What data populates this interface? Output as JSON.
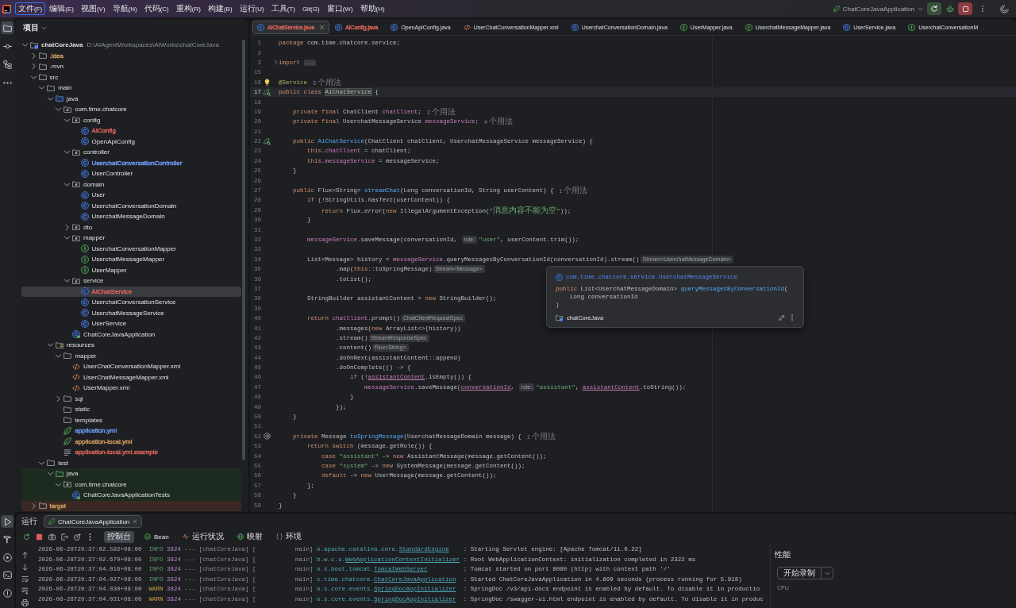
{
  "title_bar": {
    "menu": [
      {
        "label": "文件(F)",
        "selected": true
      },
      {
        "label": "编辑(E)",
        "selected": false
      },
      {
        "label": "视图(V)",
        "selected": false
      },
      {
        "label": "导航(N)",
        "selected": false
      },
      {
        "label": "代码(C)",
        "selected": false
      },
      {
        "label": "重构(R)",
        "selected": false
      },
      {
        "label": "构建(B)",
        "selected": false
      },
      {
        "label": "运行(U)",
        "selected": false
      },
      {
        "label": "工具(T)",
        "selected": false
      },
      {
        "label": "Git(G)",
        "selected": false
      },
      {
        "label": "窗口(W)",
        "selected": false
      },
      {
        "label": "帮助(H)",
        "selected": false
      }
    ],
    "run_config": {
      "label": "ChatCoreJavaApplication"
    }
  },
  "tool_strip": [
    {
      "kind": "project",
      "selected": true
    },
    {
      "kind": "commit",
      "selected": false
    },
    {
      "kind": "structure",
      "selected": false
    },
    {
      "kind": "more",
      "selected": false
    }
  ],
  "project": {
    "title": "项目",
    "tree": {
      "label": "chatCoreJava",
      "path": "D:\\AIAgentWorkspaces\\AIWorks\\chatCoreJava",
      "kind": "module",
      "expanded": true,
      "selected": false,
      "children": [
        {
          "label": ".idea",
          "kind": "folder",
          "expanded": false,
          "selected": false,
          "color": "#cf9a5e"
        },
        {
          "label": ".mvn",
          "kind": "folder",
          "expanded": false,
          "selected": false
        },
        {
          "label": "src",
          "kind": "folder",
          "expanded": true,
          "selected": false,
          "children": [
            {
              "label": "main",
              "kind": "folder",
              "expanded": true,
              "selected": false,
              "children": [
                {
                  "label": "java",
                  "kind": "source-folder",
                  "expanded": true,
                  "selected": false,
                  "children": [
                    {
                      "label": "com.time.chatcore",
                      "kind": "package",
                      "expanded": true,
                      "selected": false,
                      "children": [
                        {
                          "label": "config",
                          "kind": "package",
                          "expanded": true,
                          "selected": false,
                          "children": [
                            {
                              "label": "AiConfig",
                              "kind": "class",
                              "selected": false,
                              "color": "#d8645a"
                            },
                            {
                              "label": "OpenApiConfig",
                              "kind": "class",
                              "selected": false
                            }
                          ]
                        },
                        {
                          "label": "controller",
                          "kind": "package",
                          "expanded": true,
                          "selected": false,
                          "children": [
                            {
                              "label": "UserchatConversationController",
                              "kind": "class",
                              "selected": false,
                              "color": "#6b9bf5"
                            },
                            {
                              "label": "UserController",
                              "kind": "class",
                              "selected": false
                            }
                          ]
                        },
                        {
                          "label": "domain",
                          "kind": "package",
                          "expanded": true,
                          "selected": false,
                          "children": [
                            {
                              "label": "User",
                              "kind": "class",
                              "selected": false
                            },
                            {
                              "label": "UserchatConversationDomain",
                              "kind": "class",
                              "selected": false
                            },
                            {
                              "label": "UserchatMessageDomain",
                              "kind": "class",
                              "selected": false
                            }
                          ]
                        },
                        {
                          "label": "dto",
                          "kind": "package",
                          "expanded": false,
                          "selected": false
                        },
                        {
                          "label": "mapper",
                          "kind": "package",
                          "expanded": true,
                          "selected": false,
                          "children": [
                            {
                              "label": "UserchatConversationMapper",
                              "kind": "interface",
                              "selected": false
                            },
                            {
                              "label": "UserchatMessageMapper",
                              "kind": "interface",
                              "selected": false
                            },
                            {
                              "label": "UserMapper",
                              "kind": "interface",
                              "selected": false
                            }
                          ]
                        },
                        {
                          "label": "service",
                          "kind": "package",
                          "expanded": true,
                          "selected": false,
                          "children": [
                            {
                              "label": "AiChatService",
                              "kind": "class",
                              "selected": true,
                              "color": "#d8645a"
                            },
                            {
                              "label": "UserchatConversationService",
                              "kind": "class",
                              "selected": false
                            },
                            {
                              "label": "UserchatMessageService",
                              "kind": "class",
                              "selected": false
                            },
                            {
                              "label": "UserService",
                              "kind": "class",
                              "selected": false
                            }
                          ]
                        },
                        {
                          "label": "ChatCoreJavaApplication",
                          "kind": "app-class",
                          "selected": false
                        }
                      ]
                    }
                  ]
                },
                {
                  "label": "resources",
                  "kind": "resource-folder",
                  "expanded": true,
                  "selected": false,
                  "children": [
                    {
                      "label": "mapper",
                      "kind": "folder",
                      "expanded": true,
                      "selected": false,
                      "children": [
                        {
                          "label": "UserChatConversationMapper.xml",
                          "kind": "xml",
                          "selected": false
                        },
                        {
                          "label": "UserChatMessageMapper.xml",
                          "kind": "xml",
                          "selected": false
                        },
                        {
                          "label": "UserMapper.xml",
                          "kind": "xml",
                          "selected": false
                        }
                      ]
                    },
                    {
                      "label": "sql",
                      "kind": "folder",
                      "expanded": false,
                      "selected": false
                    },
                    {
                      "label": "static",
                      "kind": "folder",
                      "selected": false
                    },
                    {
                      "label": "templates",
                      "kind": "folder",
                      "selected": false
                    },
                    {
                      "label": "application.yml",
                      "kind": "spring-config",
                      "selected": false,
                      "color": "#6b9bf5"
                    },
                    {
                      "label": "application-local.yml",
                      "kind": "spring-config",
                      "selected": false,
                      "color": "#cf9a5e"
                    },
                    {
                      "label": "application-local.yml.example",
                      "kind": "text",
                      "selected": false,
                      "color": "#d8645a"
                    }
                  ]
                }
              ]
            },
            {
              "label": "test",
              "kind": "folder",
              "expanded": true,
              "selected": false,
              "children": [
                {
                  "label": "java",
                  "kind": "test-folder",
                  "expanded": true,
                  "selected": false,
                  "children": [
                    {
                      "label": "com.time.chatcore",
                      "kind": "test-package",
                      "expanded": true,
                      "selected": false,
                      "children": [
                        {
                          "label": "ChatCoreJavaApplicationTests",
                          "kind": "test-class",
                          "selected": false
                        }
                      ]
                    }
                  ]
                }
              ]
            }
          ]
        },
        {
          "label": "target",
          "kind": "excluded-folder",
          "expanded": false,
          "selected": false,
          "color": "#cf9a5e"
        }
      ]
    }
  },
  "editor": {
    "tabs": [
      {
        "label": "AiChatService.java",
        "kind": "class",
        "selected": true,
        "color": "#d8645a"
      },
      {
        "label": "AiConfig.java",
        "kind": "class",
        "selected": false,
        "color": "#d8645a"
      },
      {
        "label": "OpenApiConfig.java",
        "kind": "class",
        "selected": false
      },
      {
        "label": "UserChatConversationMapper.xml",
        "kind": "xml",
        "selected": false
      },
      {
        "label": "UserchatConversationDomain.java",
        "kind": "class",
        "selected": false
      },
      {
        "label": "UserMapper.java",
        "kind": "interface",
        "selected": false
      },
      {
        "label": "UserchatMessageMapper.java",
        "kind": "interface",
        "selected": false
      },
      {
        "label": "UserService.java",
        "kind": "class",
        "selected": false
      },
      {
        "label": "UserchatConversationM",
        "kind": "interface",
        "selected": false
      }
    ],
    "lines": [
      {
        "number": "1",
        "current": false,
        "tokens": [
          {
            "kind": "kw",
            "text": "package"
          },
          {
            "kind": "plain",
            "text": " com.time.chatcore.service;"
          }
        ]
      },
      {
        "number": "2",
        "current": false
      },
      {
        "number": "3",
        "current": false,
        "gutter": {
          "kind": "fold"
        },
        "tokens": [
          {
            "kind": "kw",
            "text": "import "
          },
          {
            "kind": "fold",
            "text": "..."
          }
        ]
      },
      {
        "number": "15",
        "current": false
      },
      {
        "number": "16",
        "current": false,
        "gutter": {
          "kind": "bulb"
        },
        "tokens": [
          {
            "kind": "ann",
            "text": "@Service"
          },
          {
            "kind": "usage",
            "text": "3 个用法"
          }
        ]
      },
      {
        "number": "17",
        "current": true,
        "gutter": {
          "kind": "bean"
        },
        "tokens": [
          {
            "kind": "kw",
            "text": "public class "
          },
          {
            "kind": "ident",
            "text": "AiChatService"
          },
          {
            "kind": "plain",
            "text": " {"
          }
        ]
      },
      {
        "number": "18",
        "current": false
      },
      {
        "number": "19",
        "current": false,
        "tokens": [
          {
            "kind": "kw",
            "text": "    private final"
          },
          {
            "kind": "plain",
            "text": " ChatClient "
          },
          {
            "kind": "field",
            "text": "chatClient"
          },
          {
            "kind": "plain",
            "text": ";"
          },
          {
            "kind": "usage",
            "text": "2 个用法"
          }
        ]
      },
      {
        "number": "20",
        "current": false,
        "tokens": [
          {
            "kind": "kw",
            "text": "    private final"
          },
          {
            "kind": "plain",
            "text": " UserchatMessageService "
          },
          {
            "kind": "field",
            "text": "messageService"
          },
          {
            "kind": "plain",
            "text": ";"
          },
          {
            "kind": "usage",
            "text": "4 个用法"
          }
        ]
      },
      {
        "number": "21",
        "current": false
      },
      {
        "number": "22",
        "current": false,
        "gutter": {
          "kind": "bean"
        },
        "tokens": [
          {
            "kind": "kw",
            "text": "    public "
          },
          {
            "kind": "decl",
            "text": "AiChatService"
          },
          {
            "kind": "plain",
            "text": "(ChatClient chatClient, UserchatMessageService messageService) {"
          }
        ]
      },
      {
        "number": "23",
        "current": false,
        "tokens": [
          {
            "kind": "kw",
            "text": "        this"
          },
          {
            "kind": "plain",
            "text": "."
          },
          {
            "kind": "field",
            "text": "chatClient"
          },
          {
            "kind": "plain",
            "text": " = chatClient;"
          }
        ]
      },
      {
        "number": "24",
        "current": false,
        "tokens": [
          {
            "kind": "kw",
            "text": "        this"
          },
          {
            "kind": "plain",
            "text": "."
          },
          {
            "kind": "field",
            "text": "messageService"
          },
          {
            "kind": "plain",
            "text": " = messageService;"
          }
        ]
      },
      {
        "number": "25",
        "current": false,
        "tokens": [
          {
            "kind": "plain",
            "text": "    }"
          }
        ]
      },
      {
        "number": "26",
        "current": false
      },
      {
        "number": "27",
        "current": false,
        "tokens": [
          {
            "kind": "kw",
            "text": "    public"
          },
          {
            "kind": "plain",
            "text": " Flux<String> "
          },
          {
            "kind": "decl",
            "text": "streamChat"
          },
          {
            "kind": "plain",
            "text": "(Long conversationId, String userContent) {"
          },
          {
            "kind": "usage",
            "text": "1 个用法"
          }
        ]
      },
      {
        "number": "28",
        "current": false,
        "tokens": [
          {
            "kind": "kw",
            "text": "        if"
          },
          {
            "kind": "plain",
            "text": " (!StringUtils."
          },
          {
            "kind": "static",
            "text": "hasText"
          },
          {
            "kind": "plain",
            "text": "(userContent)) {"
          }
        ]
      },
      {
        "number": "29",
        "current": false,
        "tokens": [
          {
            "kind": "kw",
            "text": "            return"
          },
          {
            "kind": "plain",
            "text": " Flux."
          },
          {
            "kind": "static",
            "text": "error"
          },
          {
            "kind": "plain",
            "text": "("
          },
          {
            "kind": "kw",
            "text": "new"
          },
          {
            "kind": "plain",
            "text": " IllegalArgumentException("
          },
          {
            "kind": "str",
            "text": "\"消息内容不能为空\""
          },
          {
            "kind": "plain",
            "text": "));"
          }
        ]
      },
      {
        "number": "30",
        "current": false,
        "tokens": [
          {
            "kind": "plain",
            "text": "        }"
          }
        ]
      },
      {
        "number": "31",
        "current": false
      },
      {
        "number": "32",
        "current": false,
        "tokens": [
          {
            "kind": "field",
            "text": "        messageService"
          },
          {
            "kind": "plain",
            "text": ".saveMessage(conversationId, "
          },
          {
            "kind": "param",
            "text": "role:"
          },
          {
            "kind": "str",
            "text": "\"user\""
          },
          {
            "kind": "plain",
            "text": ", userContent.trim());"
          }
        ]
      },
      {
        "number": "33",
        "current": false
      },
      {
        "number": "34",
        "current": false,
        "tokens": [
          {
            "kind": "plain",
            "text": "        List<Message> history = "
          },
          {
            "kind": "field",
            "text": "messageService"
          },
          {
            "kind": "plain",
            "text": ".queryMessagesByConversationId(conversationId).stream()"
          },
          {
            "kind": "type",
            "text": "Stream<UserchatMessageDomain>"
          }
        ]
      },
      {
        "number": "35",
        "current": false,
        "tokens": [
          {
            "kind": "plain",
            "text": "                .map("
          },
          {
            "kind": "kw",
            "text": "this"
          },
          {
            "kind": "plain",
            "text": "::toSpringMessage)"
          },
          {
            "kind": "type",
            "text": "Stream<Message>"
          }
        ]
      },
      {
        "number": "36",
        "current": false,
        "tokens": [
          {
            "kind": "plain",
            "text": "                .toList();"
          }
        ]
      },
      {
        "number": "37",
        "current": false
      },
      {
        "number": "38",
        "current": false,
        "tokens": [
          {
            "kind": "plain",
            "text": "        StringBuilder assistantContent = "
          },
          {
            "kind": "kw",
            "text": "new"
          },
          {
            "kind": "plain",
            "text": " StringBuilder();"
          }
        ]
      },
      {
        "number": "39",
        "current": false
      },
      {
        "number": "40",
        "current": false,
        "tokens": [
          {
            "kind": "kw",
            "text": "        return "
          },
          {
            "kind": "field",
            "text": "chatClient"
          },
          {
            "kind": "plain",
            "text": ".prompt()"
          },
          {
            "kind": "type",
            "text": "ChatClientRequestSpec"
          }
        ]
      },
      {
        "number": "41",
        "current": false,
        "tokens": [
          {
            "kind": "plain",
            "text": "                .messages("
          },
          {
            "kind": "kw",
            "text": "new"
          },
          {
            "kind": "plain",
            "text": " ArrayList<>(history))"
          }
        ]
      },
      {
        "number": "42",
        "current": false,
        "tokens": [
          {
            "kind": "plain",
            "text": "                .stream()"
          },
          {
            "kind": "type",
            "text": "StreamResponseSpec"
          }
        ]
      },
      {
        "number": "43",
        "current": false,
        "tokens": [
          {
            "kind": "plain",
            "text": "                .content()"
          },
          {
            "kind": "type",
            "text": "Flux<String>"
          }
        ]
      },
      {
        "number": "44",
        "current": false,
        "tokens": [
          {
            "kind": "plain",
            "text": "                .doOnNext(assistantContent::append)"
          }
        ]
      },
      {
        "number": "45",
        "current": false,
        "tokens": [
          {
            "kind": "plain",
            "text": "                .doOnComplete(() -> {"
          }
        ]
      },
      {
        "number": "46",
        "current": false,
        "tokens": [
          {
            "kind": "kw",
            "text": "                    if"
          },
          {
            "kind": "plain",
            "text": " (!"
          },
          {
            "kind": "captured",
            "text": "assistantContent"
          },
          {
            "kind": "plain",
            "text": ".isEmpty()) {"
          }
        ]
      },
      {
        "number": "47",
        "current": false,
        "tokens": [
          {
            "kind": "field",
            "text": "                        messageService"
          },
          {
            "kind": "plain",
            "text": ".saveMessage("
          },
          {
            "kind": "captured",
            "text": "conversationId"
          },
          {
            "kind": "plain",
            "text": ", "
          },
          {
            "kind": "param",
            "text": "role:"
          },
          {
            "kind": "str",
            "text": "\"assistant\""
          },
          {
            "kind": "plain",
            "text": ", "
          },
          {
            "kind": "captured",
            "text": "assistantContent"
          },
          {
            "kind": "plain",
            "text": ".toString());"
          }
        ]
      },
      {
        "number": "48",
        "current": false,
        "tokens": [
          {
            "kind": "plain",
            "text": "                    }"
          }
        ]
      },
      {
        "number": "49",
        "current": false,
        "tokens": [
          {
            "kind": "plain",
            "text": "                });"
          }
        ]
      },
      {
        "number": "50",
        "current": false,
        "tokens": [
          {
            "kind": "plain",
            "text": "    }"
          }
        ]
      },
      {
        "number": "51",
        "current": false
      },
      {
        "number": "52",
        "current": false,
        "gutter": {
          "kind": "at"
        },
        "tokens": [
          {
            "kind": "kw",
            "text": "    private"
          },
          {
            "kind": "plain",
            "text": " Message "
          },
          {
            "kind": "decl",
            "text": "toSpringMessage"
          },
          {
            "kind": "plain",
            "text": "(UserchatMessageDomain message) {"
          },
          {
            "kind": "usage",
            "text": "1 个用法"
          }
        ]
      },
      {
        "number": "53",
        "current": false,
        "tokens": [
          {
            "kind": "kw",
            "text": "        return switch"
          },
          {
            "kind": "plain",
            "text": " (message.getRole()) {"
          }
        ]
      },
      {
        "number": "54",
        "current": false,
        "tokens": [
          {
            "kind": "kw",
            "text": "            case "
          },
          {
            "kind": "str",
            "text": "\"assistant\""
          },
          {
            "kind": "plain",
            "text": " -> "
          },
          {
            "kind": "kw",
            "text": "new"
          },
          {
            "kind": "plain",
            "text": " AssistantMessage(message.getContent());"
          }
        ]
      },
      {
        "number": "55",
        "current": false,
        "tokens": [
          {
            "kind": "kw",
            "text": "            case "
          },
          {
            "kind": "str",
            "text": "\"system\""
          },
          {
            "kind": "plain",
            "text": " -> "
          },
          {
            "kind": "kw",
            "text": "new"
          },
          {
            "kind": "plain",
            "text": " SystemMessage(message.getContent());"
          }
        ]
      },
      {
        "number": "56",
        "current": false,
        "tokens": [
          {
            "kind": "kw",
            "text": "            default"
          },
          {
            "kind": "plain",
            "text": " -> "
          },
          {
            "kind": "kw",
            "text": "new"
          },
          {
            "kind": "plain",
            "text": " UserMessage(message.getContent());"
          }
        ]
      },
      {
        "number": "57",
        "current": false,
        "tokens": [
          {
            "kind": "plain",
            "text": "        };"
          }
        ]
      },
      {
        "number": "58",
        "current": false,
        "tokens": [
          {
            "kind": "plain",
            "text": "    }"
          }
        ]
      },
      {
        "number": "59",
        "current": false,
        "tokens": [
          {
            "kind": "plain",
            "text": "}"
          }
        ]
      }
    ],
    "doc_popup": {
      "qualified_name": "com.time.chatcore.service.UserchatMessageService",
      "signature": [
        {
          "tokens": [
            {
              "kind": "kw",
              "text": "public"
            },
            {
              "kind": "plain",
              "text": " List<UserchatMessageDomain> "
            },
            {
              "kind": "decl",
              "text": "queryMessagesByConversationId"
            },
            {
              "kind": "plain",
              "text": "("
            }
          ]
        },
        {
          "tokens": [
            {
              "kind": "plain",
              "text": "    Long conversationId"
            }
          ]
        },
        {
          "tokens": [
            {
              "kind": "plain",
              "text": ")"
            }
          ]
        }
      ],
      "module": "chatCoreJava"
    }
  },
  "bottom_strip": [
    {
      "kind": "run",
      "selected": true
    },
    {
      "kind": "build",
      "selected": false
    },
    {
      "kind": "services",
      "selected": false
    },
    {
      "kind": "terminal",
      "selected": false
    },
    {
      "kind": "problems",
      "selected": false
    }
  ],
  "run": {
    "title": "运行",
    "tabs": [
      {
        "label": "ChatCoreJavaApplication",
        "selected": true
      }
    ],
    "views": [
      {
        "kind": "console",
        "label": "控制台",
        "selected": true
      },
      {
        "kind": "beans",
        "label": "Bean",
        "selected": false
      },
      {
        "kind": "health",
        "label": "运行状况",
        "selected": false
      },
      {
        "kind": "mappings",
        "label": "映射",
        "selected": false
      },
      {
        "kind": "environment",
        "label": "环境",
        "selected": false
      }
    ],
    "console": [
      {
        "kind": "info",
        "parts": [
          {
            "kind": "time",
            "text": "2026-06-28T20:37:02.592+08:00"
          },
          {
            "kind": "level",
            "text": "  INFO"
          },
          {
            "kind": "pid",
            "text": " 3824"
          },
          {
            "kind": "meta",
            "text": " --- [chatCoreJava] [           main] "
          },
          {
            "kind": "logger",
            "text": "o.apache.catalina.core."
          },
          {
            "kind": "link",
            "text": "StandardEngine"
          },
          {
            "kind": "msg",
            "text": "    : Starting Servlet engine: [Apache Tomcat/11.0.22]"
          }
        ]
      },
      {
        "kind": "info",
        "parts": [
          {
            "kind": "time",
            "text": "2026-06-28T20:37:02.670+08:00"
          },
          {
            "kind": "level",
            "text": "  INFO"
          },
          {
            "kind": "pid",
            "text": " 3824"
          },
          {
            "kind": "meta",
            "text": " --- [chatCoreJava] [           main] "
          },
          {
            "kind": "logger",
            "text": "b.w.c.s."
          },
          {
            "kind": "link",
            "text": "WebApplicationContextInitializer"
          },
          {
            "kind": "msg",
            "text": " : Root WebApplicationContext: initialization completed in 2322 ms"
          }
        ]
      },
      {
        "kind": "info",
        "parts": [
          {
            "kind": "time",
            "text": "2026-06-28T20:37:04.016+08:00"
          },
          {
            "kind": "level",
            "text": "  INFO"
          },
          {
            "kind": "pid",
            "text": " 3824"
          },
          {
            "kind": "meta",
            "text": " --- [chatCoreJava] [           main] "
          },
          {
            "kind": "logger",
            "text": "o.s.boot.tomcat."
          },
          {
            "kind": "link",
            "text": "TomcatWebServer"
          },
          {
            "kind": "msg",
            "text": "          : Tomcat started on port 8080 (http) with context path '/'"
          }
        ]
      },
      {
        "kind": "info",
        "parts": [
          {
            "kind": "time",
            "text": "2026-06-28T20:37:04.027+08:00"
          },
          {
            "kind": "level",
            "text": "  INFO"
          },
          {
            "kind": "pid",
            "text": " 3824"
          },
          {
            "kind": "meta",
            "text": " --- [chatCoreJava] [           main] "
          },
          {
            "kind": "logger",
            "text": "c.time.chatcore."
          },
          {
            "kind": "link",
            "text": "ChatCoreJavaApplication"
          },
          {
            "kind": "msg",
            "text": "  : Started ChatCoreJavaApplication in 4.609 seconds (process running for 5.918)"
          }
        ]
      },
      {
        "kind": "warn",
        "parts": [
          {
            "kind": "time",
            "text": "2026-06-28T20:37:04.030+08:00"
          },
          {
            "kind": "level",
            "text": "  WARN"
          },
          {
            "kind": "pid",
            "text": " 3824"
          },
          {
            "kind": "meta",
            "text": " --- [chatCoreJava] [           main] "
          },
          {
            "kind": "logger",
            "text": "o.s.core.events."
          },
          {
            "kind": "link",
            "text": "SpringDocAppInitializer"
          },
          {
            "kind": "msg",
            "text": "  : SpringDoc /v3/api-docs endpoint is enabled by default. To disable it in productio"
          }
        ]
      },
      {
        "kind": "warn",
        "parts": [
          {
            "kind": "time",
            "text": "2026-06-28T20:37:04.031+08:00"
          },
          {
            "kind": "level",
            "text": "  WARN"
          },
          {
            "kind": "pid",
            "text": " 3824"
          },
          {
            "kind": "meta",
            "text": " --- [chatCoreJava] [           main] "
          },
          {
            "kind": "logger",
            "text": "o.s.core.events."
          },
          {
            "kind": "link",
            "text": "SpringDocAppInitializer"
          },
          {
            "kind": "msg",
            "text": "  : SpringDoc /swagger-ui.html endpoint is enabled by default. To disable it in produc"
          }
        ]
      }
    ],
    "performance": {
      "title": "性能",
      "button": "开始录制",
      "label": "CPU"
    }
  }
}
